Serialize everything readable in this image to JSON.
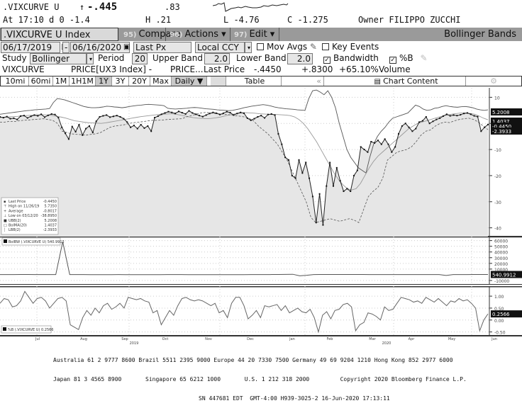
{
  "header": {
    "ticker": ".VIXCURVE U",
    "arrow": "↑",
    "last": "-.445",
    "change": ".83",
    "at_time": "At 17:10 d 0 -1.4",
    "high": "H .21",
    "low": "L -4.76",
    "close": "C -1.275",
    "owner": "Owner FILIPPO ZUCCHI"
  },
  "toolbar": {
    "security": ".VIXCURVE U Index",
    "compare_num": "95)",
    "compare": "Compare",
    "actions_num": "96)",
    "actions": "Actions ▾",
    "edit_num": "97)",
    "edit": "Edit ▾",
    "title": "Bollinger Bands"
  },
  "range_row": {
    "start_date": "06/17/2019",
    "dash": "-",
    "end_date": "06/16/2020",
    "price_field": "Last Px",
    "currency": "Local CCY",
    "mov_avgs_label": "Mov Avgs",
    "mov_avgs_checked": false,
    "key_events_label": "Key Events",
    "key_events_checked": false
  },
  "study_row": {
    "study_label": "Study",
    "study_value": "Bollinger",
    "period_label": "Period",
    "period_value": "20",
    "upper_label": "Upper Band",
    "upper_value": "2.0",
    "lower_label": "Lower Band",
    "lower_value": "2.0",
    "bandwidth_label": "Bandwidth",
    "bandwidth_checked": true,
    "pctb_label": "%B",
    "pctb_checked": true
  },
  "info_row": {
    "name": "VIXCURVE",
    "formula": "PRICE[UX3 Index] -",
    "formula2": "PRICE...",
    "last_price_label": "Last Price",
    "last_price": "-.4450",
    "change": "+.8300",
    "pct_change": "+65.10%",
    "volume_label": "Volume"
  },
  "tabs": {
    "items": [
      "10mi",
      "60mi",
      "1M",
      "1H1M",
      "1Y",
      "3Y",
      "20Y",
      "Max"
    ],
    "selected": "1Y",
    "frequency": "Daily ▼",
    "table": "Table",
    "collapse": "«",
    "chart_content": "Chart Content",
    "settings_icon": "gear-icon"
  },
  "chart_data": [
    {
      "type": "line",
      "title": "Bollinger Bands (.VIXCURVE U Index)",
      "ylim": [
        -42,
        12
      ],
      "y_ticks": [
        10,
        0,
        -10,
        -20,
        -30,
        -40
      ],
      "grid": true,
      "legend_position": "bottom-left",
      "legend": [
        {
          "label": "Last Price",
          "value": "-0.4450"
        },
        {
          "label": "High on 11/26/19",
          "value": "5.7350"
        },
        {
          "label": "Average",
          "value": "-0.8017"
        },
        {
          "label": "Low on 03/12/20",
          "value": "-38.8950"
        },
        {
          "label": "UBB(2)",
          "value": "5.2008"
        },
        {
          "label": "BolMA(20)",
          "value": "1.4037"
        },
        {
          "label": "LBB(2)",
          "value": "-2.3933"
        }
      ],
      "last_value_labels": [
        "5.2008",
        "1.4037",
        "-0.4450",
        "-2.3933"
      ],
      "series": [
        {
          "name": "Last Price",
          "values": [
            2.5,
            2.2,
            2.6,
            1.8,
            2.0,
            1.5,
            2.8,
            3.0,
            2.1,
            2.7,
            3.2,
            2.9,
            3.5,
            2.4,
            3.1,
            3.6,
            3.4,
            2.2,
            -1.5,
            -3.8,
            -6.0,
            -1.2,
            -3.2,
            -0.5,
            -4.5,
            -2.0,
            -1.0,
            -3.5,
            0.8,
            2.5,
            2.9,
            3.2,
            2.4,
            2.7,
            3.0,
            2.5,
            1.8,
            0.5,
            -1.5,
            -0.8,
            -2.0,
            -0.5,
            -1.8,
            -1.0,
            -3.0,
            2.2,
            2.8,
            3.5,
            4.0,
            4.5,
            4.2,
            3.8,
            4.6,
            4.1,
            3.6,
            4.8,
            4.0,
            3.5,
            3.0,
            2.6,
            3.2,
            3.8,
            4.2,
            3.9,
            3.4,
            3.9,
            4.5,
            4.1,
            3.2,
            3.8,
            4.2,
            3.9,
            2.0,
            1.2,
            1.8,
            2.5,
            3.0,
            2.1,
            3.4,
            3.6,
            3.2,
            -4.0,
            -8.0,
            -13.0,
            -14.0,
            -20.0,
            -21.0,
            -14.0,
            -19.0,
            -15.0,
            -21.0,
            -28.0,
            -38.0,
            -27.0,
            -38.9,
            -24.0,
            -15.0,
            -24.0,
            -17.0,
            -22.0,
            -26.0,
            -25.0,
            -26.0,
            -20.0,
            -18.0,
            -9.0,
            -10.0,
            -11.0,
            -7.0,
            -7.5,
            -6.5,
            -8.0,
            -6.0,
            -8.0,
            -11.0,
            -9.0,
            -4.0,
            -1.0,
            0.0,
            -1.5,
            -3.0,
            -2.0,
            0.5,
            1.0,
            2.5,
            0.0,
            0.8,
            1.5,
            2.0,
            2.8,
            3.5,
            2.9,
            3.2,
            3.0,
            3.3,
            3.8,
            4.0,
            3.5,
            2.9,
            2.6,
            -3.0,
            -1.5,
            -0.445
          ]
        },
        {
          "name": "UBB(2)",
          "values": [
            3.5,
            3.7,
            3.9,
            4.1,
            4.3,
            4.5,
            4.7,
            4.9,
            5.0,
            5.2,
            5.3,
            5.4,
            5.5,
            5.7,
            8.0,
            9.5,
            9.3,
            9.0,
            8.5,
            8.0,
            7.5,
            7.0,
            6.5,
            6.2,
            6.0,
            6.0,
            6.1,
            6.3,
            6.6,
            6.5,
            6.3,
            6.2,
            6.0,
            6.2,
            6.5,
            6.7,
            6.9,
            7.0,
            7.2,
            7.3,
            7.2,
            7.1,
            7.0,
            6.8,
            5.8,
            5.6,
            5.5,
            5.6,
            5.7,
            5.8,
            6.0,
            6.1,
            6.0,
            5.8,
            5.6,
            5.5,
            5.4,
            5.2,
            5.1,
            5.0,
            4.9,
            5.0,
            5.3,
            5.6,
            6.0,
            6.3,
            6.6,
            6.8,
            7.0,
            7.2,
            7.0,
            6.7,
            6.3,
            6.0,
            5.8,
            5.6,
            5.5,
            5.4,
            5.2,
            5.1,
            5.0,
            9.5,
            12.5,
            12.8,
            12.0,
            11.0,
            12.5,
            10.0,
            6.0,
            0.0,
            -5.0,
            -10.0,
            -13.0,
            -15.0,
            -17.0,
            -18.0,
            -19.0,
            -13.0,
            -8.0,
            -5.0,
            -3.0,
            -1.5,
            0.5,
            2.0,
            2.5,
            3.0,
            3.5,
            4.0,
            5.5,
            7.0,
            6.5,
            5.5,
            5.0,
            5.2,
            5.8,
            6.0,
            6.5,
            6.8,
            6.5,
            6.3,
            6.2,
            6.4,
            6.5,
            6.3,
            6.0,
            5.5,
            5.2,
            5.0,
            5.2
          ]
        },
        {
          "name": "BolMA(20)",
          "values": [
            2.2,
            2.4,
            2.5,
            2.6,
            2.7,
            2.9,
            3.0,
            3.1,
            3.2,
            3.3,
            3.3,
            3.2,
            3.0,
            2.7,
            2.4,
            2.0,
            1.5,
            1.0,
            0.8,
            0.5,
            0.3,
            0.2,
            0.1,
            0.0,
            0.2,
            0.5,
            0.8,
            1.1,
            1.4,
            1.7,
            2.0,
            2.3,
            2.6,
            2.8,
            3.0,
            3.2,
            3.4,
            3.5,
            3.6,
            3.7,
            3.5,
            3.2,
            2.9,
            2.5,
            2.2,
            2.0,
            1.9,
            1.8,
            1.9,
            2.1,
            2.4,
            2.8,
            3.2,
            3.5,
            3.8,
            4.0,
            4.1,
            4.0,
            3.9,
            3.7,
            3.6,
            3.5,
            3.4,
            3.4,
            3.3,
            3.2,
            3.0,
            2.5,
            1.5,
            0.0,
            -2.0,
            -4.5,
            -7.0,
            -10.0,
            -13.0,
            -16.0,
            -19.0,
            -21.5,
            -23.5,
            -25.0,
            -25.5,
            -25.0,
            -23.0,
            -20.0,
            -17.0,
            -14.5,
            -12.5,
            -11.0,
            -9.5,
            -8.0,
            -6.5,
            -5.0,
            -3.5,
            -2.0,
            -1.0,
            0.0,
            0.5,
            1.0,
            1.5,
            2.0,
            2.5,
            3.0,
            3.3,
            3.6,
            3.8,
            4.0,
            4.0,
            3.8,
            3.5,
            2.8,
            2.0,
            1.4
          ]
        },
        {
          "name": "LBB(2)",
          "values": [
            0.5,
            0.5,
            0.8,
            0.7,
            1.0,
            1.2,
            1.3,
            1.5,
            1.6,
            1.8,
            1.5,
            1.2,
            0.0,
            -3.0,
            -3.5,
            -4.0,
            -4.2,
            -4.3,
            -4.5,
            -4.2,
            -4.0,
            -3.5,
            -2.5,
            -1.5,
            -1.0,
            -0.8,
            -0.5,
            0.0,
            0.3,
            0.5,
            0.7,
            1.0,
            1.2,
            1.2,
            1.3,
            1.5,
            1.6,
            1.7,
            1.8,
            2.5,
            3.0,
            3.5,
            4.0,
            4.2,
            4.0,
            3.8,
            3.6,
            3.5,
            3.3,
            3.0,
            2.8,
            2.5,
            2.0,
            1.0,
            -1.0,
            -2.5,
            -4.0,
            -6.0,
            -8.0,
            -11.0,
            -14.0,
            -18.0,
            -22.0,
            -26.0,
            -30.0,
            -36.0,
            -38.0,
            -37.5,
            -37.0,
            -36.5,
            -37.0,
            -37.5,
            -37.0,
            -36.5,
            -37.0,
            -38.0,
            -33.0,
            -28.0,
            -26.0,
            -24.5,
            -21.0,
            -14.0,
            -12.5,
            -11.0,
            -10.5,
            -10.0,
            -9.0,
            -7.0,
            -4.5,
            -3.0,
            -2.5,
            -1.0,
            0.0,
            0.5,
            0.3,
            1.0,
            1.5,
            1.8,
            2.0,
            1.5,
            0.5,
            -1.0,
            -2.3933
          ]
        }
      ]
    },
    {
      "type": "line",
      "title": "BolBW (.VIXCURVE U)",
      "legend": [
        {
          "label": "BolBW (.VIXCURVE U)",
          "value": "540.9912"
        }
      ],
      "ylim": [
        -15000,
        62000
      ],
      "y_ticks": [
        60000,
        50000,
        40000,
        30000,
        20000,
        10000,
        -10000
      ],
      "last_value_label": "540.9912",
      "grid": true,
      "series": [
        {
          "name": "BolBW",
          "values": [
            400,
            380,
            420,
            450,
            500,
            420,
            380,
            350,
            300,
            58000,
            350,
            320,
            300,
            280,
            260,
            250,
            240,
            300,
            280,
            260,
            240,
            250,
            260,
            280,
            300,
            320,
            300,
            280,
            260,
            250,
            240,
            230,
            220,
            240,
            260,
            280,
            300,
            350,
            400,
            450,
            500,
            700,
            900,
            -1800,
            -900,
            400,
            500,
            520,
            540,
            560,
            500,
            480,
            460,
            440,
            420,
            400,
            380,
            360,
            350,
            340,
            330,
            320,
            340,
            360,
            -1200,
            380,
            400,
            420,
            450,
            500,
            540.9912
          ]
        }
      ]
    },
    {
      "type": "line",
      "title": "%B (.VIXCURVE U)",
      "legend": [
        {
          "label": "%B (.VIXCURVE U)",
          "value": "0.2566"
        }
      ],
      "ylim": [
        -0.6,
        1.3
      ],
      "y_ticks": [
        1.0,
        0.5,
        0.0,
        -0.5
      ],
      "last_value_label": "0.2566",
      "grid": true,
      "x_tick_labels": [
        "Jul",
        "Aug",
        "Sep",
        "Oct",
        "Nov",
        "Dec",
        "Jan",
        "Feb",
        "Mar",
        "Apr",
        "May",
        "Jun"
      ],
      "year_labels": [
        "2019",
        "2020"
      ],
      "series": [
        {
          "name": "%B",
          "values": [
            0.7,
            0.9,
            0.85,
            0.55,
            0.6,
            0.8,
            1.2,
            0.95,
            0.7,
            0.9,
            0.95,
            0.8,
            0.5,
            0.7,
            0.9,
            0.95,
            0.8,
            -0.2,
            -0.3,
            -0.4,
            0.1,
            0.4,
            0.2,
            0.5,
            0.3,
            0.6,
            0.7,
            0.45,
            0.55,
            0.7,
            0.5,
            0.95,
            0.9,
            0.85,
            0.9,
            0.8,
            0.75,
            0.3,
            0.4,
            -0.2,
            0.1,
            0.4,
            0.2,
            0.6,
            0.9,
            0.95,
            0.85,
            0.8,
            0.85,
            0.8,
            0.7,
            0.6,
            0.7,
            0.3,
            0.4,
            0.1,
            0.7,
            0.95,
            0.95,
            0.6,
            0.05,
            0.2,
            0.4,
            0.1,
            0.6,
            0.55,
            0.6,
            0.65,
            0.4,
            0.6,
            0.3,
            0.4,
            0.5,
            0.35,
            0.3,
            0.45,
            0.1,
            -0.5,
            0.2,
            0.35,
            0.05,
            0.4,
            0.45,
            0.65,
            0.7,
            0.55,
            -0.45,
            -0.2,
            -0.1,
            0.3,
            0.25,
            0.15,
            0.0,
            0.55,
            0.4,
            0.45,
            0.7,
            0.95,
            0.9,
            0.85,
            0.75,
            0.8,
            0.7,
            0.95,
            0.85,
            0.75,
            0.9,
            0.75,
            0.6,
            0.8,
            0.75,
            0.9,
            0.8,
            0.85,
            0.7,
            0.5,
            -0.45,
            0.0,
            0.2566
          ]
        }
      ]
    }
  ],
  "footer": {
    "line1": "Australia 61 2 9777 8600 Brazil 5511 2395 9000 Europe 44 20 7330 7500 Germany 49 69 9204 1210 Hong Kong 852 2977 6000",
    "line2": "Japan 81 3 4565 8900       Singapore 65 6212 1000       U.S. 1 212 318 2000         Copyright 2020 Bloomberg Finance L.P.",
    "line3": "SN 447681 EDT  GMT-4:00 H939-3025-2 16-Jun-2020 17:13:11"
  }
}
